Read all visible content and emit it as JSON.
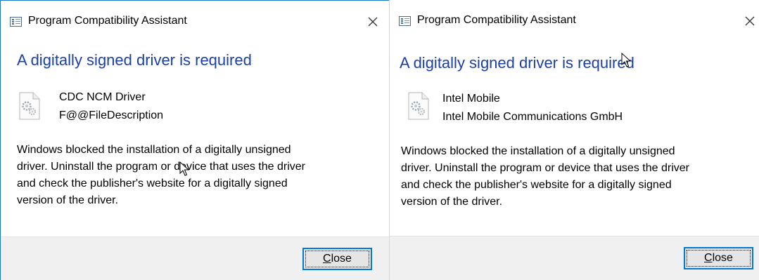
{
  "dialogs": [
    {
      "window_title": "Program Compatibility Assistant",
      "heading": "A digitally signed driver is required",
      "driver_name": "CDC NCM Driver",
      "driver_description": "F@@FileDescription",
      "message_lines": [
        "Windows blocked the installation of a digitally unsigned",
        "driver.  Uninstall the program or device that uses the driver",
        "and check the publisher's website for a digitally signed",
        "version of the driver."
      ],
      "close_button": {
        "mnemonic": "C",
        "rest": "lose"
      }
    },
    {
      "window_title": "Program Compatibility Assistant",
      "heading": "A digitally signed driver is required",
      "driver_name": "Intel Mobile",
      "driver_description": "Intel Mobile Communications GmbH",
      "message_lines": [
        "Windows blocked the installation of a digitally unsigned",
        "driver.  Uninstall the program or device that uses the driver",
        "and check the publisher's website for a digitally signed",
        "version of the driver."
      ],
      "close_button": {
        "mnemonic": "C",
        "rest": "lose"
      }
    }
  ],
  "icons": {
    "app": "program-compatibility-icon",
    "driver": "driver-gear-file-icon",
    "close": "close-icon",
    "cursor": "mouse-cursor-icon"
  },
  "colors": {
    "heading": "#1b3fa8",
    "active_border": "#1979ca",
    "footer": "#f0f0f0",
    "button_focus": "#0078d7"
  }
}
